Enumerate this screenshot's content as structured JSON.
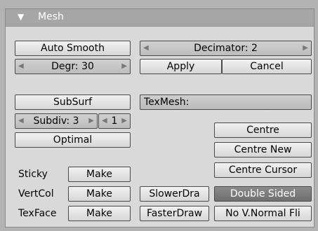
{
  "panel": {
    "title": "Mesh"
  },
  "auto_smooth": "Auto Smooth",
  "degr": {
    "label": "Degr: 30"
  },
  "decimator": {
    "label": "Decimator: 2"
  },
  "apply": "Apply",
  "cancel": "Cancel",
  "subsurf": "SubSurf",
  "texmesh": {
    "label": "TexMesh:"
  },
  "subdiv": {
    "label": "Subdiv: 3",
    "render_label": "1"
  },
  "optimal": "Optimal",
  "centre": "Centre",
  "centre_new": "Centre New",
  "centre_cursor": "Centre Cursor",
  "sticky": {
    "label": "Sticky",
    "button": "Make"
  },
  "vertcol": {
    "label": "VertCol",
    "button": "Make"
  },
  "texface": {
    "label": "TexFace",
    "button": "Make"
  },
  "slower_draw": "SlowerDra",
  "faster_draw": "FasterDraw",
  "double_sided": "Double Sided",
  "no_vnormal_flip": "No V.Normal Fli",
  "icons": {
    "collapse": "triangle-down-icon",
    "decrement": "arrow-left-icon",
    "increment": "arrow-right-icon"
  }
}
